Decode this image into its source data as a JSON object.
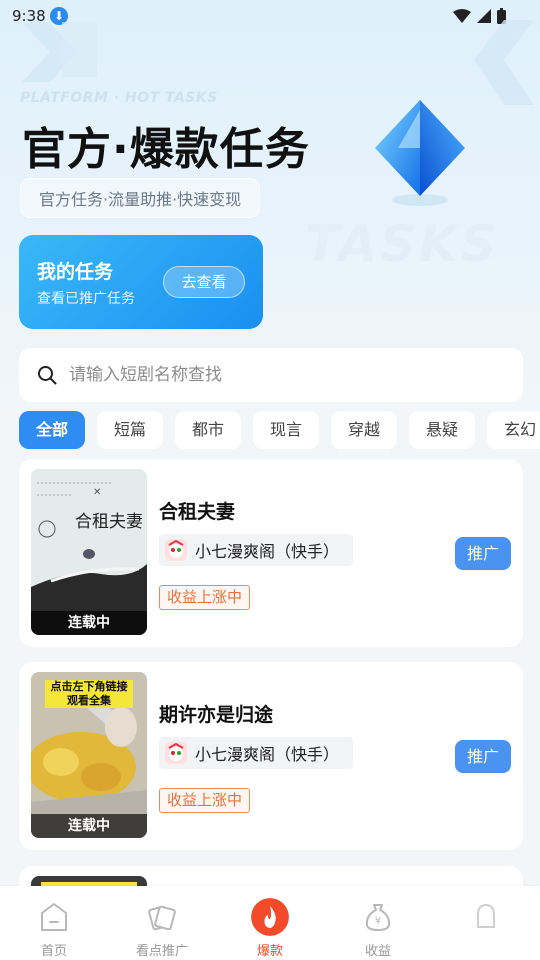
{
  "status_bar": {
    "time": "9:38"
  },
  "header": {
    "watermark": "PLATFORM · HOT TASKS",
    "title": "官方·爆款任务",
    "subtitle": "官方任务·流量助推·快速变现",
    "bg_word": "TASKS"
  },
  "my_task": {
    "title": "我的任务",
    "desc": "查看已推广任务",
    "button": "去查看"
  },
  "search": {
    "placeholder": "请输入短剧名称查找"
  },
  "tabs": [
    "全部",
    "短篇",
    "都市",
    "现言",
    "穿越",
    "悬疑",
    "玄幻"
  ],
  "cards": [
    {
      "title": "合租夫妻",
      "cover_text": "合租夫妻",
      "status": "连载中",
      "source": "小七漫爽阁（快手）",
      "badge": "收益上涨中",
      "button": "推广"
    },
    {
      "title": "期许亦是归途",
      "cover_text": "点击左下角链接\n观看全集",
      "status": "连载中",
      "source": "小七漫爽阁（快手）",
      "badge": "收益上涨中",
      "button": "推广"
    }
  ],
  "bottom_nav": [
    {
      "label": "首页",
      "icon": "home-icon"
    },
    {
      "label": "看点推广",
      "icon": "cards-icon"
    },
    {
      "label": "爆款",
      "icon": "fire-icon"
    },
    {
      "label": "收益",
      "icon": "money-bag-icon"
    },
    {
      "label": "",
      "icon": "profile-icon"
    }
  ],
  "colors": {
    "accent": "#2f8cf2",
    "fire": "#f24a2a",
    "badge": "#e9713c"
  }
}
